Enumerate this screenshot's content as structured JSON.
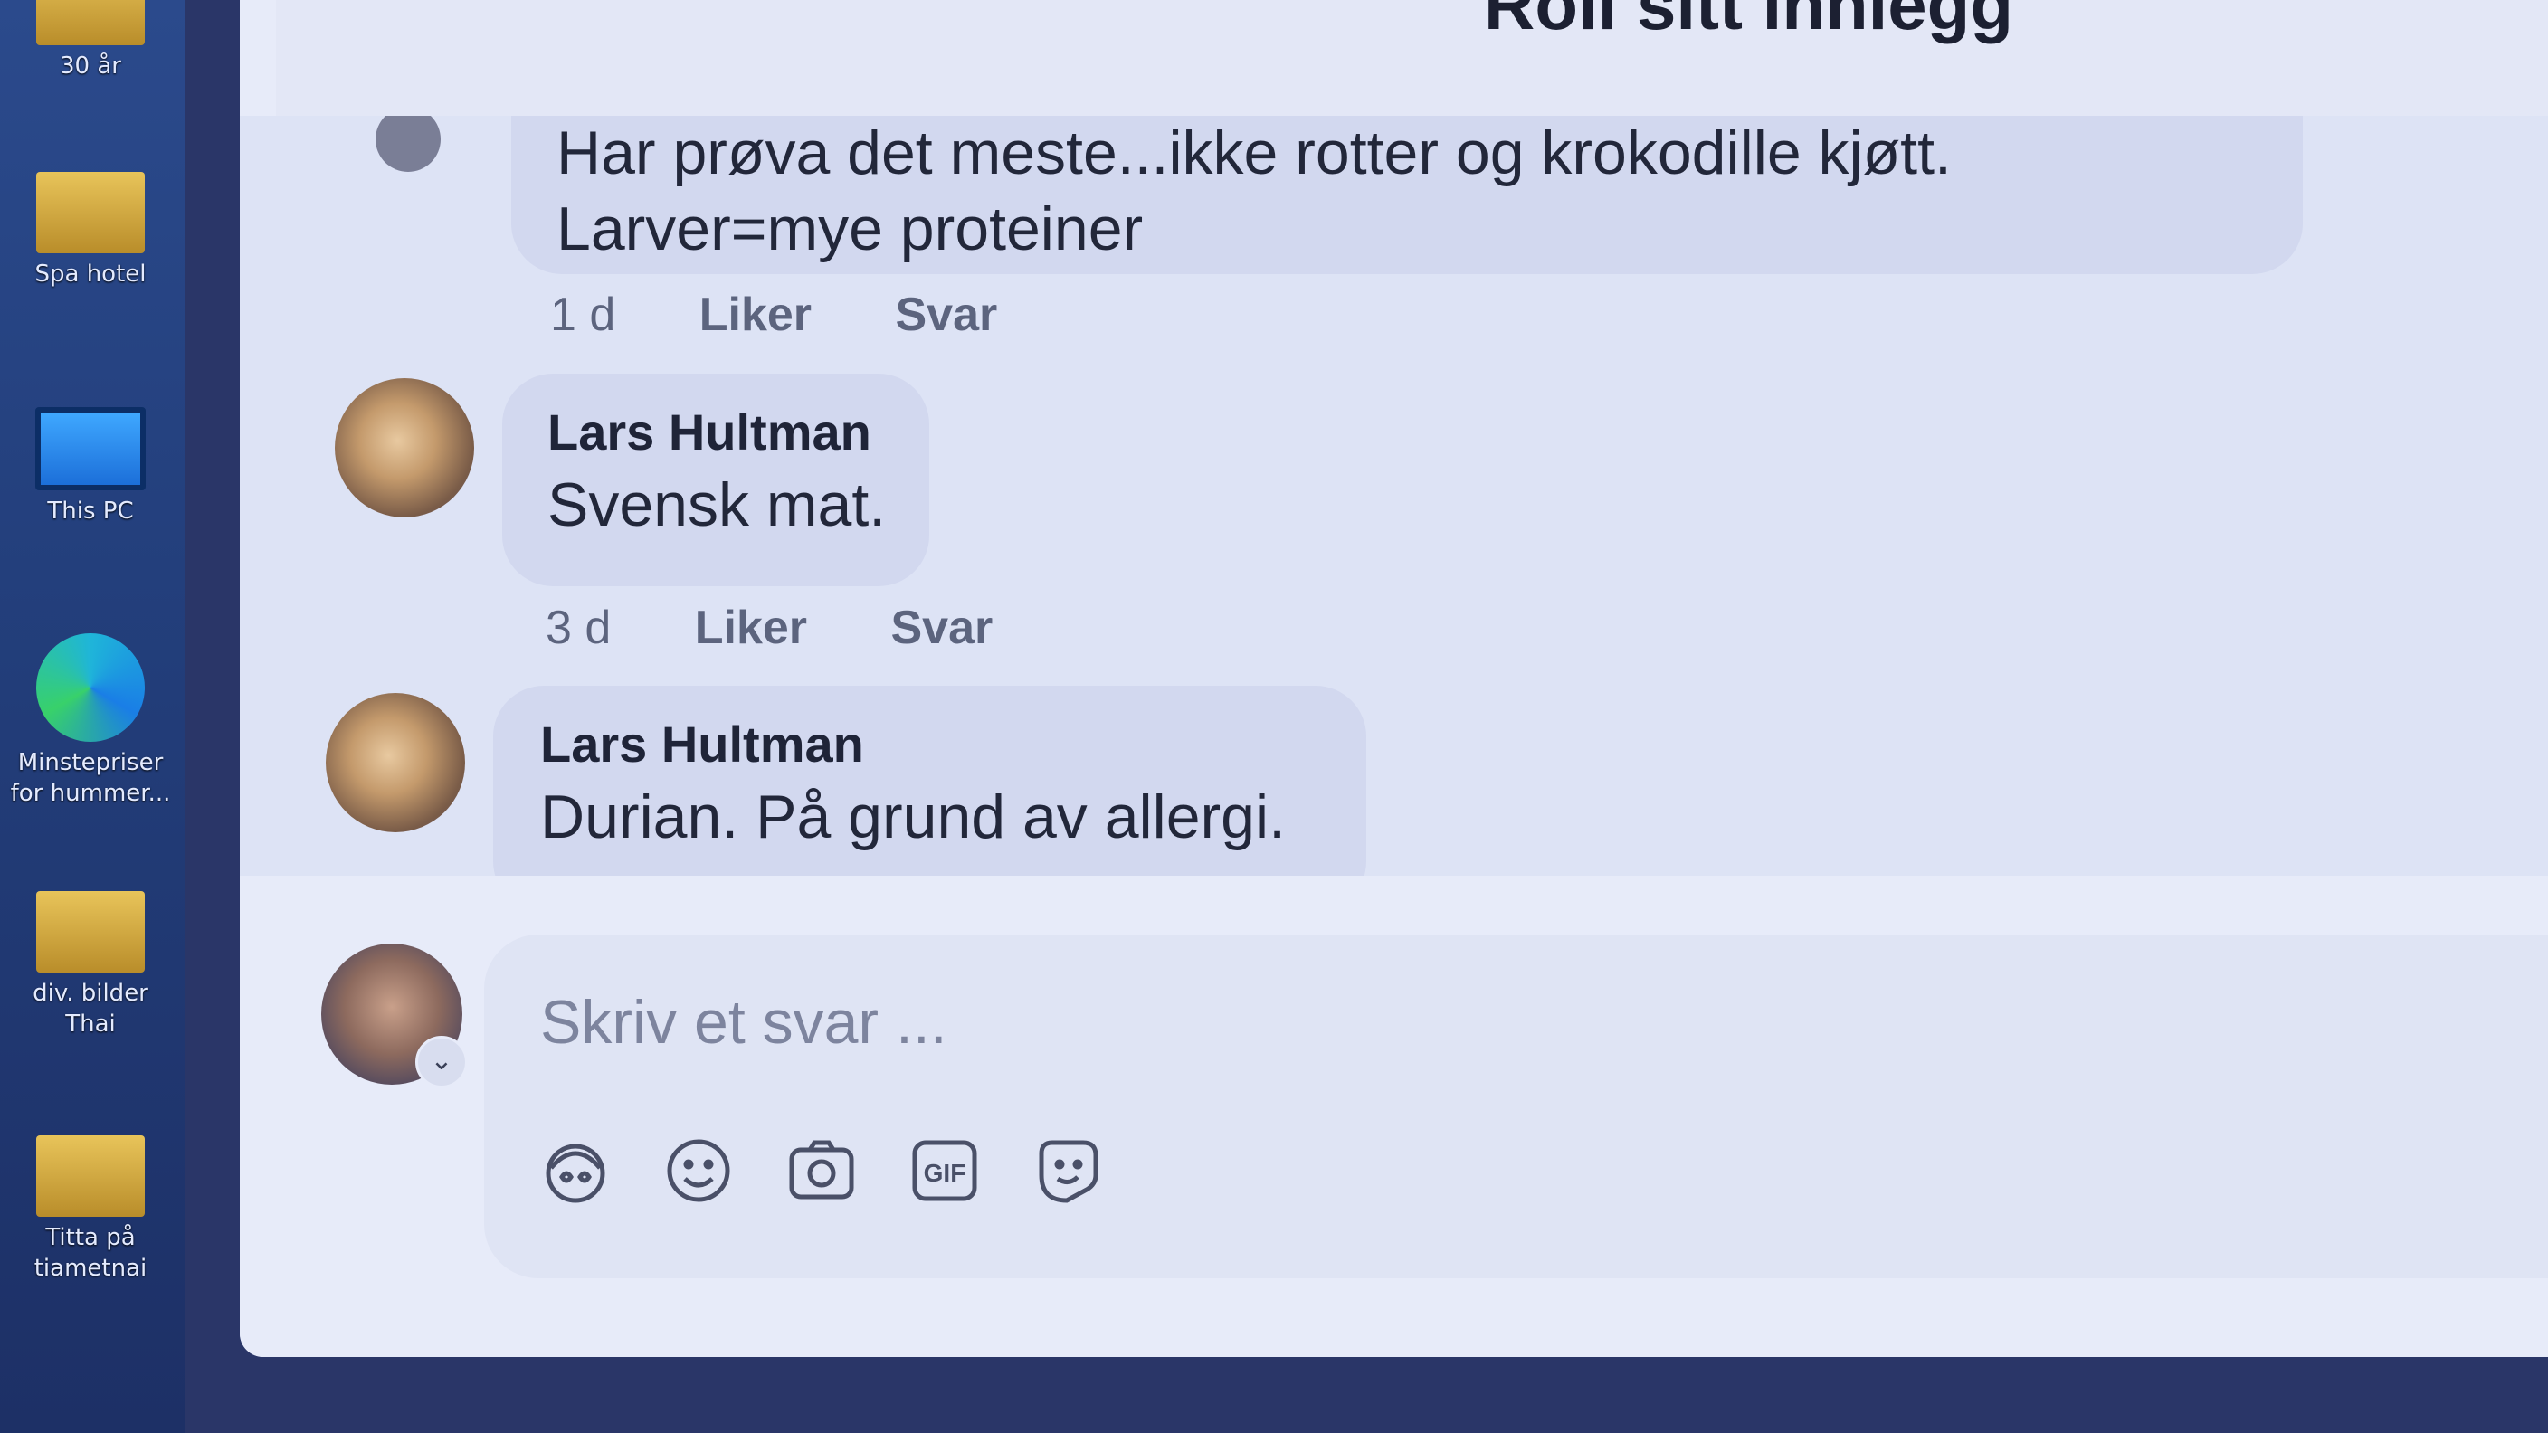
{
  "desktop": {
    "icons": [
      {
        "label": "30 år",
        "kind": "folder"
      },
      {
        "label": "Spa hotel",
        "kind": "folder"
      },
      {
        "label": "This PC",
        "kind": "monitor"
      },
      {
        "label": "Minstepriser\nfor hummer...",
        "kind": "edge"
      },
      {
        "label": "div. bilder\nThai",
        "kind": "folder"
      },
      {
        "label": "Titta på\ntiametnai",
        "kind": "folder"
      }
    ]
  },
  "dialog": {
    "title": "Roll sitt innlegg"
  },
  "comments": [
    {
      "author": "",
      "text_line1": "Har prøva det meste...ikke rotter og krokodille kjøtt.",
      "text_line2": "Larver=mye proteiner",
      "time": "1 d",
      "like": "Liker",
      "reply": "Svar"
    },
    {
      "author": "Lars Hultman",
      "text": "Svensk mat.",
      "time": "3 d",
      "like": "Liker",
      "reply": "Svar"
    },
    {
      "author": "Lars Hultman",
      "text": "Durian. På grund av allergi."
    }
  ],
  "reply": {
    "placeholder": "Skriv et svar ...",
    "tools": [
      "avatar-sticker-icon",
      "emoji-icon",
      "camera-icon",
      "gif-icon",
      "sticker-icon"
    ],
    "gif_label": "GIF"
  },
  "colors": {
    "dialog_bg": "#e7ebf9",
    "bubble_bg": "#d2d8ef",
    "desktop_bg": "#2b4a8c"
  }
}
